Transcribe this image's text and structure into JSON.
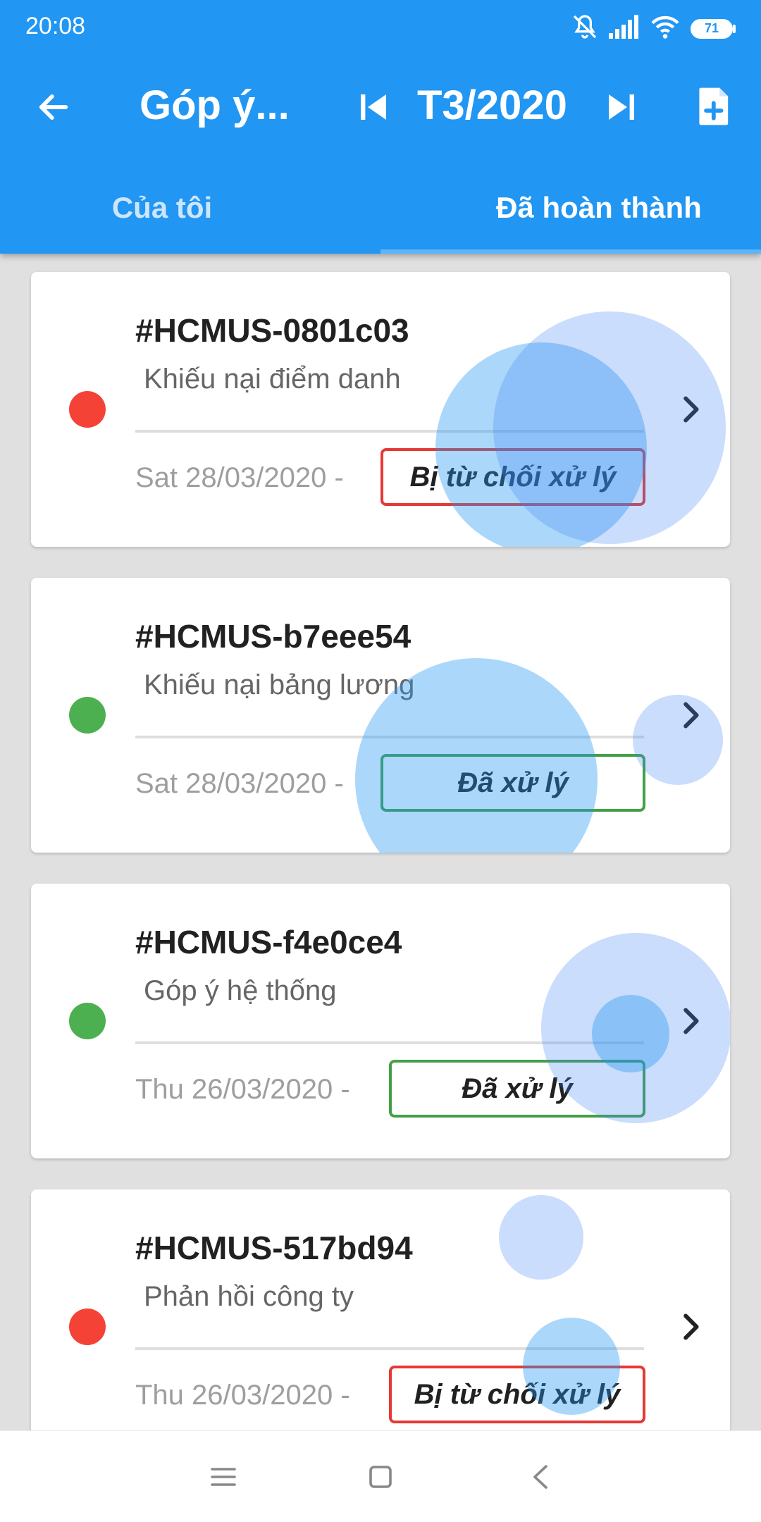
{
  "status_bar": {
    "time": "20:08",
    "battery": "71",
    "icons": [
      "mute-icon",
      "signal-icon",
      "wifi-icon",
      "battery-icon"
    ]
  },
  "toolbar": {
    "title": "Góp ý...",
    "period": "T3/2020",
    "icons": [
      "back-arrow-icon",
      "skip-previous-icon",
      "skip-next-icon",
      "add-document-icon"
    ]
  },
  "tabs": [
    {
      "label": "Của tôi",
      "active": false
    },
    {
      "label": "Đã hoàn thành",
      "active": true
    }
  ],
  "colors": {
    "primary": "#2196f3",
    "rejected": "#e53935",
    "done": "#43a047",
    "dot_red": "#f44336",
    "dot_green": "#4caf50"
  },
  "cards": [
    {
      "code": "#HCMUS-0801c03",
      "subject": "Khiếu nại điểm danh",
      "date": "Sat 28/03/2020 -",
      "status": "Bị từ chối xử lý",
      "status_type": "rejected",
      "dot": "red"
    },
    {
      "code": "#HCMUS-b7eee54",
      "subject": "Khiếu nại bảng lương",
      "date": "Sat 28/03/2020 -",
      "status": "Đã xử lý",
      "status_type": "done",
      "dot": "green"
    },
    {
      "code": "#HCMUS-f4e0ce4",
      "subject": "Góp ý hệ thống",
      "date": "Thu 26/03/2020 -",
      "status": "Đã xử lý",
      "status_type": "done",
      "dot": "green"
    },
    {
      "code": "#HCMUS-517bd94",
      "subject": "Phản hồi công ty",
      "date": "Thu 26/03/2020 -",
      "status": "Bị từ chối xử lý",
      "status_type": "rejected",
      "dot": "red"
    }
  ],
  "nav_bar": {
    "icons": [
      "menu-icon",
      "home-icon",
      "back-icon"
    ]
  }
}
